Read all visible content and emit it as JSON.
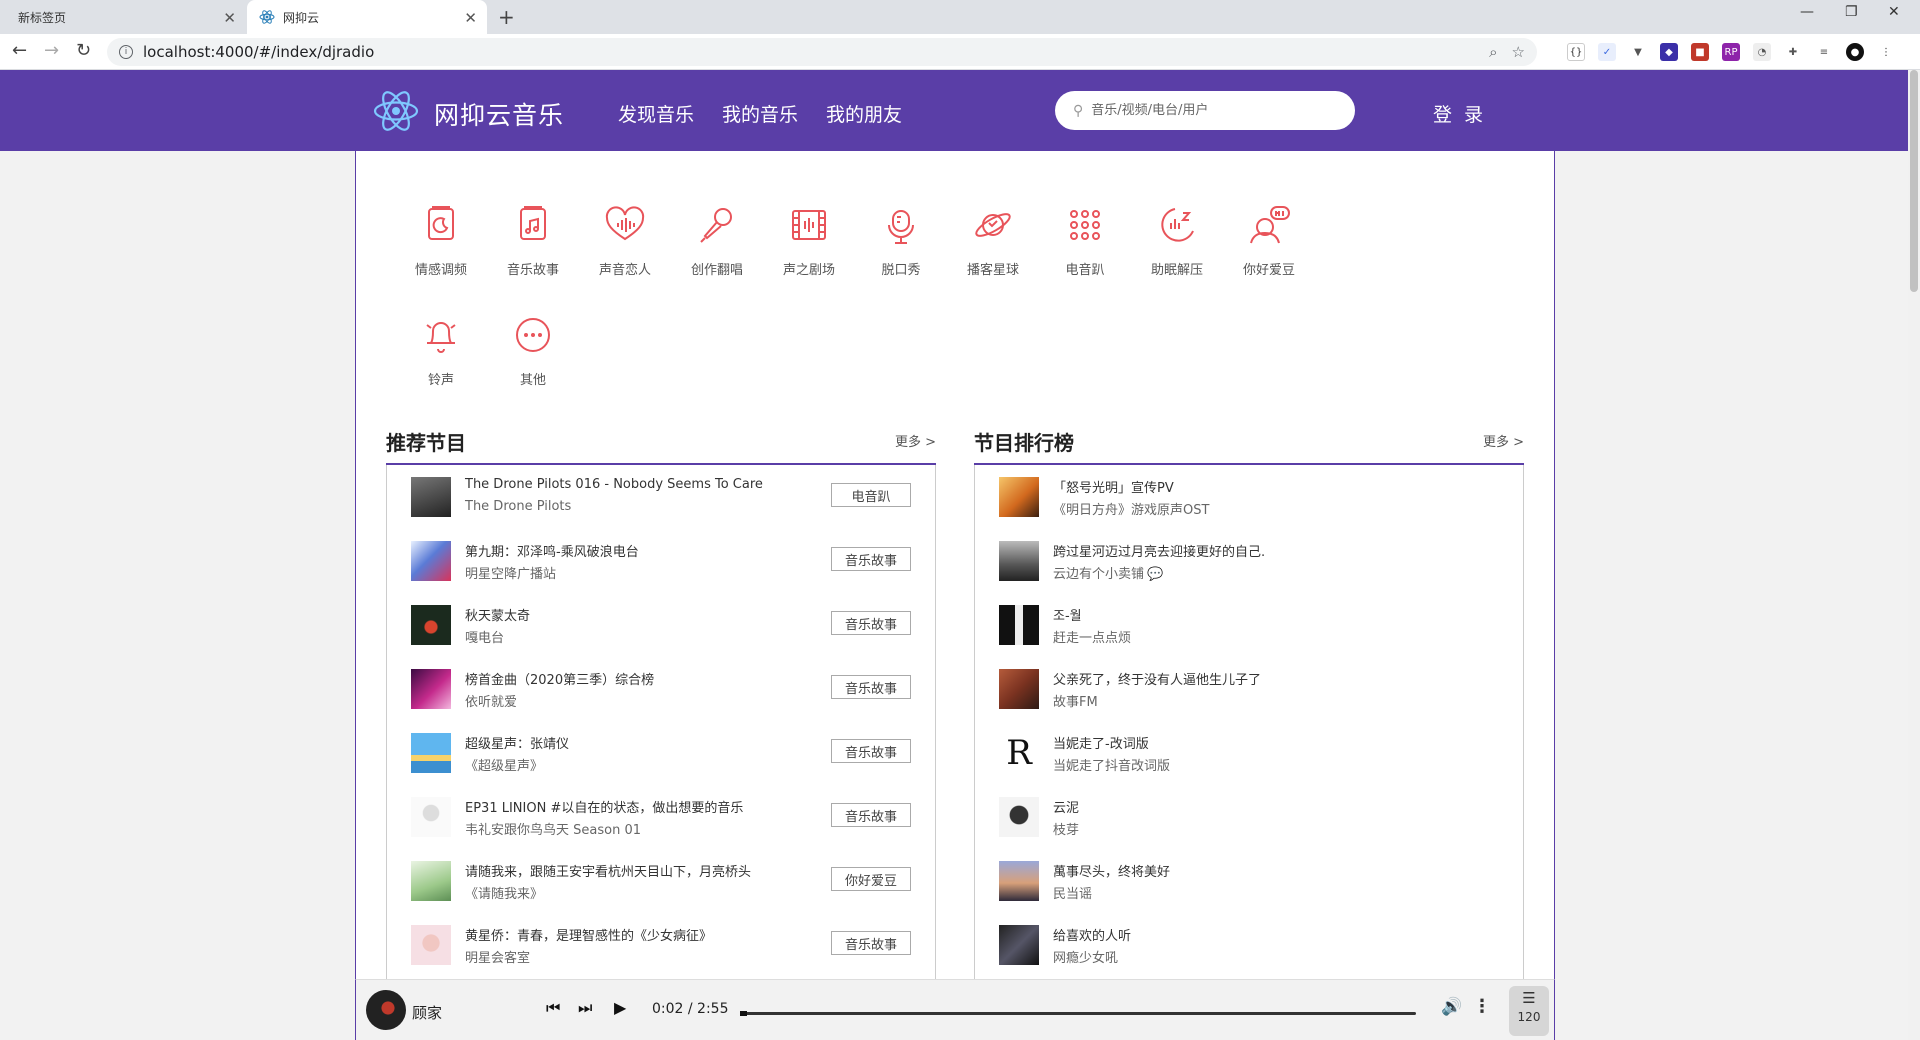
{
  "browser": {
    "tabs": [
      {
        "label": "新标签页"
      },
      {
        "label": "网抑云"
      }
    ],
    "url": "localhost:4000/#/index/djradio"
  },
  "header": {
    "brand": "网抑云音乐",
    "nav": [
      "发现音乐",
      "我的音乐",
      "我的朋友"
    ],
    "search_placeholder": "音乐/视频/电台/用户",
    "login": "登 录"
  },
  "categories": [
    {
      "label": "情感调频",
      "icon": "mood-book-icon"
    },
    {
      "label": "音乐故事",
      "icon": "music-book-icon"
    },
    {
      "label": "声音恋人",
      "icon": "voice-heart-icon"
    },
    {
      "label": "创作翻唱",
      "icon": "microphone-icon"
    },
    {
      "label": "声之剧场",
      "icon": "film-icon"
    },
    {
      "label": "脱口秀",
      "icon": "talk-mic-icon"
    },
    {
      "label": "播客星球",
      "icon": "planet-icon"
    },
    {
      "label": "电音趴",
      "icon": "dots-grid-icon"
    },
    {
      "label": "助眠解压",
      "icon": "sleep-icon"
    },
    {
      "label": "你好爱豆",
      "icon": "hi-idol-icon"
    },
    {
      "label": "铃声",
      "icon": "bell-icon"
    },
    {
      "label": "其他",
      "icon": "more-circle-icon"
    }
  ],
  "recommend": {
    "title": "推荐节目",
    "more": "更多 >",
    "items": [
      {
        "title": "The Drone Pilots 016 - Nobody Seems To Care",
        "sub": "The Drone Pilots",
        "tag": "电音趴"
      },
      {
        "title": "第九期：邓泽鸣-乘风破浪电台",
        "sub": "明星空降广播站",
        "tag": "音乐故事"
      },
      {
        "title": "秋天蒙太奇",
        "sub": "嘎电台",
        "tag": "音乐故事"
      },
      {
        "title": "榜首金曲（2020第三季）综合榜",
        "sub": "依听就爱",
        "tag": "音乐故事"
      },
      {
        "title": "超级星声：张靖仪",
        "sub": "《超级星声》",
        "tag": "音乐故事"
      },
      {
        "title": "EP31 LINION #以自在的状态，做出想要的音乐",
        "sub": "韦礼安跟你鸟鸟天 Season 01",
        "tag": "音乐故事"
      },
      {
        "title": "请随我来，跟随王安宇看杭州天目山下，月亮桥头",
        "sub": "《请随我来》",
        "tag": "你好爱豆"
      },
      {
        "title": "黄星侨：青春，是理智感性的《少女病征》",
        "sub": "明星会客室",
        "tag": "音乐故事"
      }
    ]
  },
  "ranking": {
    "title": "节目排行榜",
    "more": "更多 >",
    "items": [
      {
        "title": "「怒号光明」宣传PV",
        "sub": "《明日方舟》游戏原声OST"
      },
      {
        "title": "跨过星河迈过月亮去迎接更好的自己.",
        "sub": "云边有个小卖铺"
      },
      {
        "title": "조-월",
        "sub": "赶走一点点烦"
      },
      {
        "title": "父亲死了，终于没有人逼他生儿子了",
        "sub": "故事FM"
      },
      {
        "title": "当妮走了-改词版",
        "sub": "当妮走了抖音改词版"
      },
      {
        "title": "云泥",
        "sub": "枝芽"
      },
      {
        "title": "萬事尽头，终将美好",
        "sub": "民当谣"
      },
      {
        "title": "给喜欢的人听",
        "sub": "网瘾少女吼"
      }
    ]
  },
  "player": {
    "title": "顾家",
    "time": "0:02 / 2:55",
    "progress": 0.01,
    "playlist_count": "120"
  },
  "colors": {
    "accent": "#5a3ea7",
    "icon_red": "#e8545a"
  }
}
